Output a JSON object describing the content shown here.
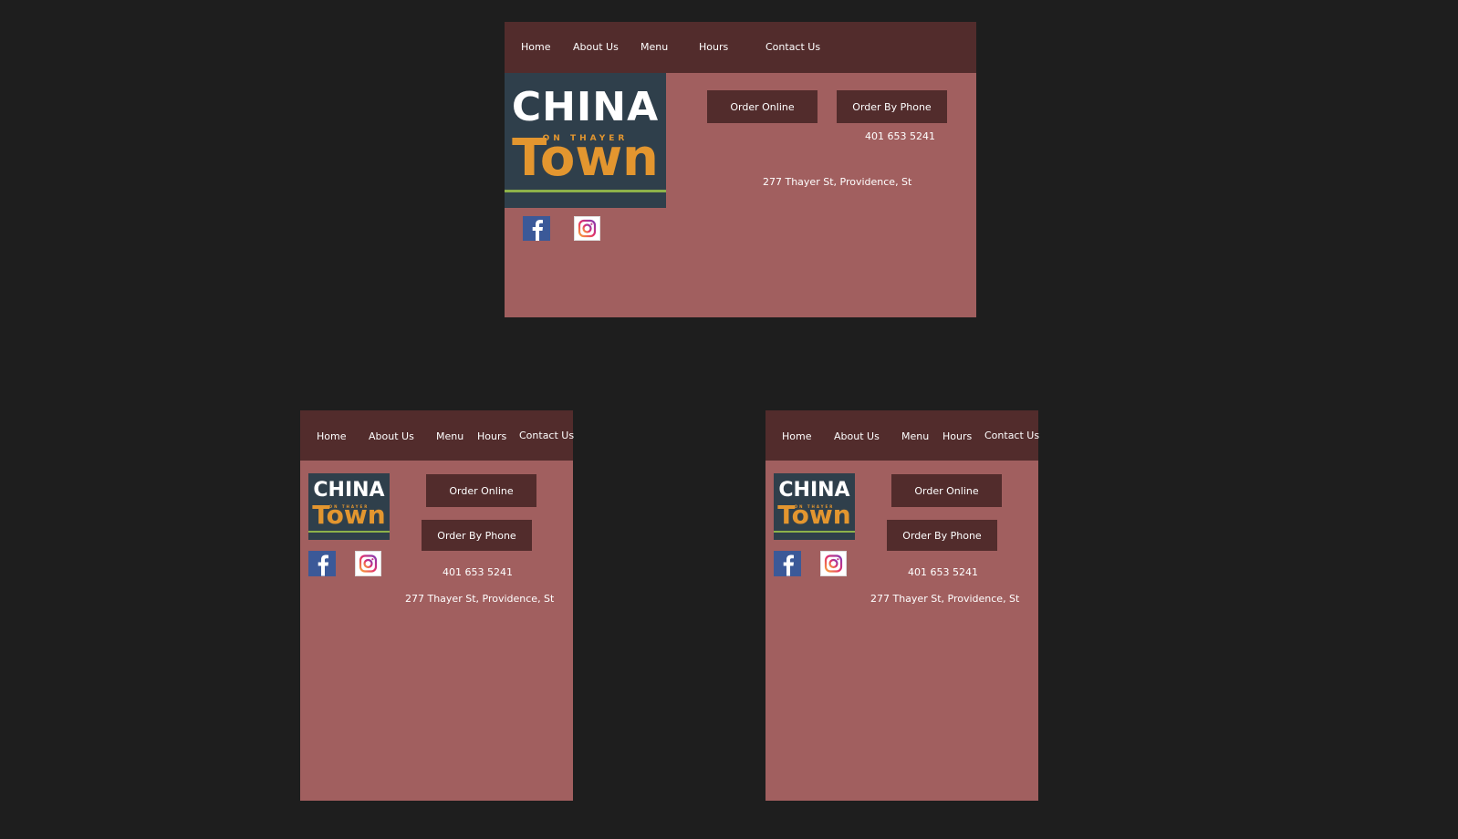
{
  "nav": {
    "home": "Home",
    "about": "About Us",
    "menu": "Menu",
    "hours": "Hours",
    "contact": "Contact Us"
  },
  "logo": {
    "line1": "CHINA",
    "line2": "ON THAYER",
    "line3": "Town"
  },
  "actions": {
    "order_online": "Order Online",
    "order_phone": "Order By Phone"
  },
  "contact": {
    "phone": "401 653 5241",
    "address": "277 Thayer St, Providence, St"
  },
  "social": {
    "facebook_icon": "facebook-icon",
    "instagram_icon": "instagram-icon"
  },
  "colors": {
    "canvas": "#1e1e1e",
    "page": "#a15f5f",
    "nav": "#522c2c",
    "logo_bg": "#2f3f4b",
    "logo_accent": "#e3962f",
    "logo_stripe": "#8db24a",
    "facebook": "#3b5998"
  }
}
